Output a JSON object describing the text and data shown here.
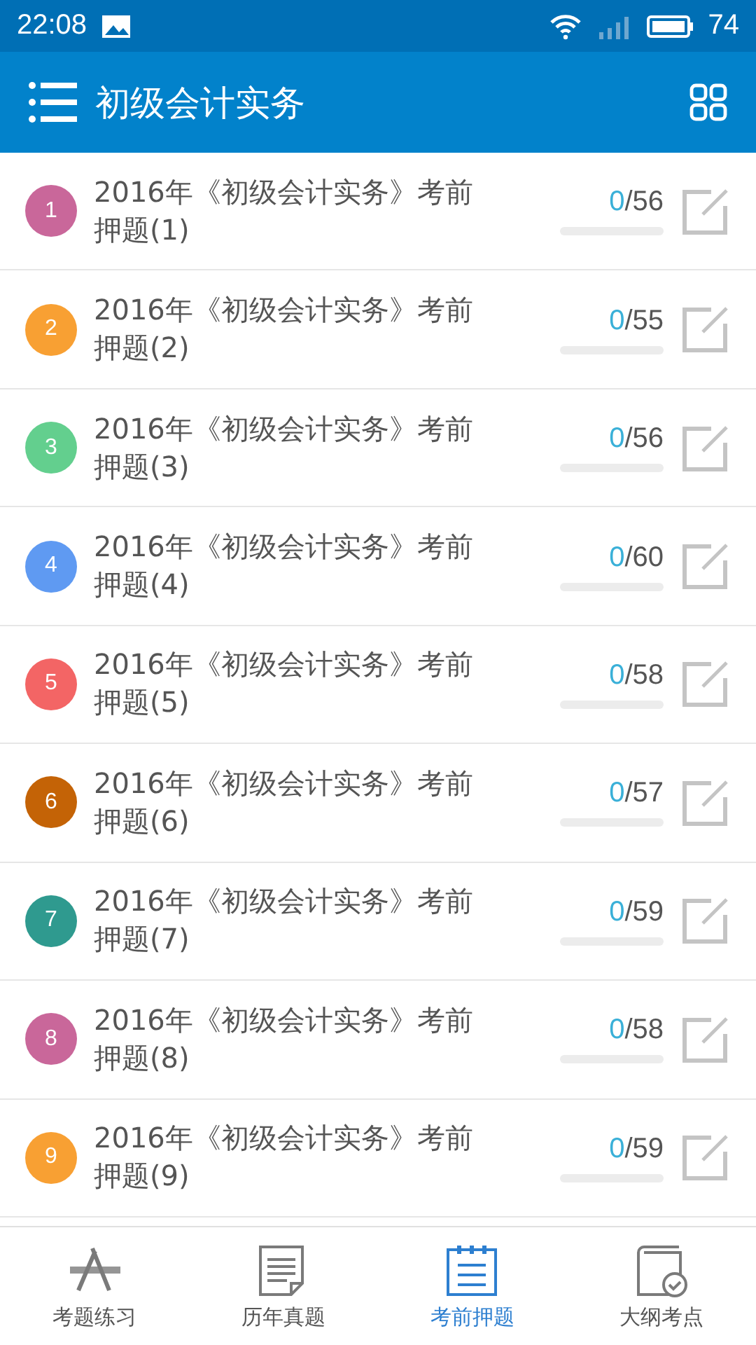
{
  "status_bar": {
    "time": "22:08",
    "battery": "74"
  },
  "app_bar": {
    "title": "初级会计实务"
  },
  "papers": [
    {
      "number": "1",
      "color": "#c9679a",
      "title": "2016年《初级会计实务》考前押题(1)",
      "answered": "0",
      "total": "/56"
    },
    {
      "number": "2",
      "color": "#f8a033",
      "title": "2016年《初级会计实务》考前押题(2)",
      "answered": "0",
      "total": "/55"
    },
    {
      "number": "3",
      "color": "#63cf8e",
      "title": "2016年《初级会计实务》考前押题(3)",
      "answered": "0",
      "total": "/56"
    },
    {
      "number": "4",
      "color": "#5f9af2",
      "title": "2016年《初级会计实务》考前押题(4)",
      "answered": "0",
      "total": "/60"
    },
    {
      "number": "5",
      "color": "#f36565",
      "title": "2016年《初级会计实务》考前押题(5)",
      "answered": "0",
      "total": "/58"
    },
    {
      "number": "6",
      "color": "#c46306",
      "title": "2016年《初级会计实务》考前押题(6)",
      "answered": "0",
      "total": "/57"
    },
    {
      "number": "7",
      "color": "#2f9a8f",
      "title": "2016年《初级会计实务》考前押题(7)",
      "answered": "0",
      "total": "/59"
    },
    {
      "number": "8",
      "color": "#c9679a",
      "title": "2016年《初级会计实务》考前押题(8)",
      "answered": "0",
      "total": "/58"
    },
    {
      "number": "9",
      "color": "#f8a033",
      "title": "2016年《初级会计实务》考前押题(9)",
      "answered": "0",
      "total": "/59"
    }
  ],
  "bottom_nav": [
    {
      "kind": "tools",
      "label": "考题练习",
      "selected": false
    },
    {
      "kind": "paper",
      "label": "历年真题",
      "selected": false
    },
    {
      "kind": "notepad",
      "label": "考前押题",
      "selected": true
    },
    {
      "kind": "book",
      "label": "大纲考点",
      "selected": false
    }
  ]
}
